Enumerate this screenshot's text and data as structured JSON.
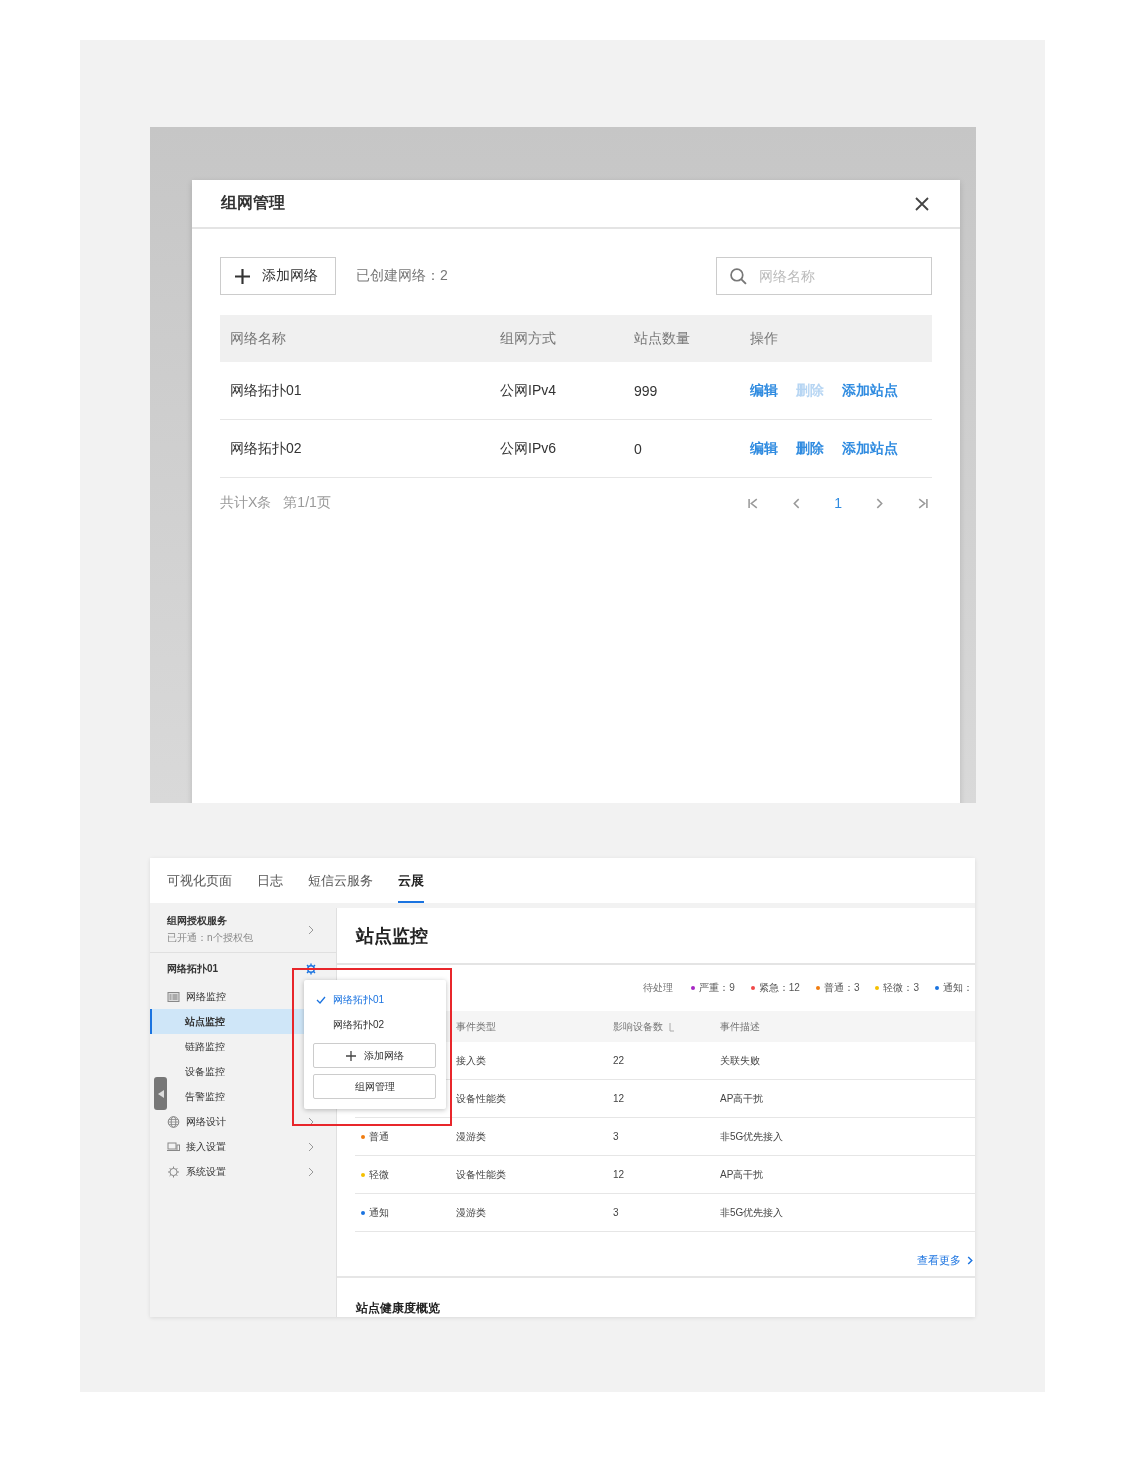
{
  "dialog": {
    "title": "组网管理",
    "toolbar": {
      "add_button": "添加网络",
      "count": "已创建网络：2",
      "search": {
        "placeholder": "网络名称"
      }
    },
    "table": {
      "columns": [
        "网络名称",
        "组网方式",
        "站点数量",
        "操作"
      ],
      "rows": [
        {
          "name": "网络拓扑01",
          "mode": "公网IPv4",
          "sites": "999",
          "actions": [
            {
              "label": "编辑",
              "disabled": false
            },
            {
              "label": "删除",
              "disabled": true
            },
            {
              "label": "添加站点",
              "disabled": false
            }
          ]
        },
        {
          "name": "网络拓扑02",
          "mode": "公网IPv6",
          "sites": "0",
          "actions": [
            {
              "label": "编辑",
              "disabled": false
            },
            {
              "label": "删除",
              "disabled": false
            },
            {
              "label": "添加站点",
              "disabled": false
            }
          ]
        }
      ]
    },
    "footer": {
      "total": "共计X条",
      "page": "第1/1页",
      "pages": [
        {
          "label": "1",
          "selected": true
        }
      ]
    }
  },
  "app": {
    "tabs": [
      {
        "label": "可视化页面",
        "selected": false
      },
      {
        "label": "日志",
        "selected": false
      },
      {
        "label": "短信云服务",
        "selected": false
      },
      {
        "label": "云展",
        "selected": true
      }
    ],
    "sidebar": {
      "service": {
        "title": "组网授权服务",
        "subtitle": "已开通：n个授权包"
      },
      "network": "网络拓扑01",
      "items": [
        {
          "label": "网络监控",
          "expanded": true,
          "children": [
            {
              "label": "站点监控",
              "selected": true
            },
            {
              "label": "链路监控",
              "selected": false
            },
            {
              "label": "设备监控",
              "selected": false
            },
            {
              "label": "告警监控",
              "selected": false
            }
          ]
        },
        {
          "label": "网络设计",
          "expanded": false
        },
        {
          "label": "接入设置",
          "expanded": false
        },
        {
          "label": "系统设置",
          "expanded": false
        }
      ]
    },
    "page_title": "站点监控",
    "summary": {
      "label": "待处理",
      "levels": [
        {
          "label": "严重：9",
          "color": "#a626c4"
        },
        {
          "label": "紧急：12",
          "color": "#f04848"
        },
        {
          "label": "普通：3",
          "color": "#f07c10"
        },
        {
          "label": "轻微：3",
          "color": "#f5c000"
        },
        {
          "label": "通知：",
          "color": "#1a73e0"
        }
      ]
    },
    "events": {
      "columns": [
        "事件类型",
        "影响设备数",
        "事件描述"
      ],
      "rows": [
        {
          "type": "接入类",
          "devices": "22",
          "description": "关联失败"
        },
        {
          "type": "设备性能类",
          "devices": "12",
          "description": "AP高干扰"
        },
        {
          "level": "普通",
          "color": "#f07c10",
          "type": "漫游类",
          "devices": "3",
          "description": "非5G优先接入"
        },
        {
          "level": "轻微",
          "color": "#f5c000",
          "type": "设备性能类",
          "devices": "12",
          "description": "AP高干扰"
        },
        {
          "level": "通知",
          "color": "#1a73e0",
          "type": "漫游类",
          "devices": "3",
          "description": "非5G优先接入"
        }
      ]
    },
    "more_link": "查看更多",
    "section_title": "站点健康度概览",
    "popup": {
      "items": [
        {
          "label": "网络拓扑01",
          "selected": true
        },
        {
          "label": "网络拓扑02",
          "selected": false
        }
      ],
      "buttons": [
        {
          "label": "添加网络",
          "kind": "add"
        },
        {
          "label": "组网管理",
          "kind": "plain"
        }
      ]
    }
  }
}
